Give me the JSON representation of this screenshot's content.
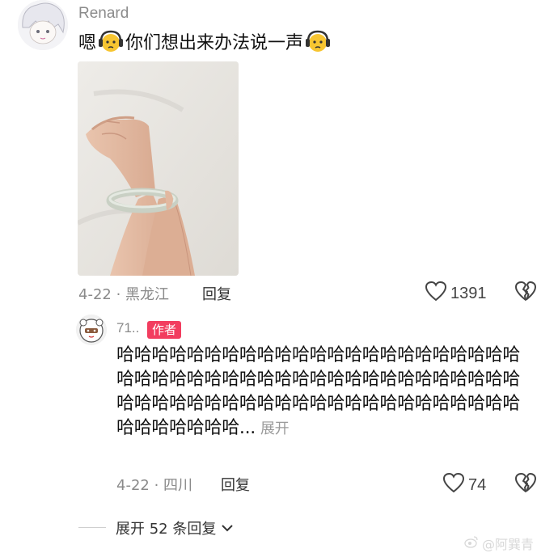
{
  "comment": {
    "username": "Renard",
    "text_parts": [
      "嗯",
      "你们想出来办法说一声"
    ],
    "emoji_name": "worried-headphones-face-emoji",
    "date_location": "4-22 · 黑龙江",
    "reply_label": "回复",
    "like_count": "1391"
  },
  "reply": {
    "username": "71..",
    "author_badge": "作者",
    "text": "哈哈哈哈哈哈哈哈哈哈哈哈哈哈哈哈哈哈哈哈哈哈哈哈哈哈哈哈哈哈哈哈哈哈哈哈哈哈哈哈哈哈哈哈哈哈哈哈哈哈哈哈哈哈哈哈哈哈哈哈哈哈哈哈哈哈哈哈哈哈哈哈哈哈哈哈...",
    "expand_label": "展开",
    "date_location": "4-22 · 四川",
    "reply_label": "回复",
    "like_count": "74"
  },
  "expand_replies_label": "展开 52 条回复",
  "watermark": "@阿巽青",
  "colors": {
    "author_badge": "#f23d5f",
    "muted_text": "#8a8a8a"
  }
}
